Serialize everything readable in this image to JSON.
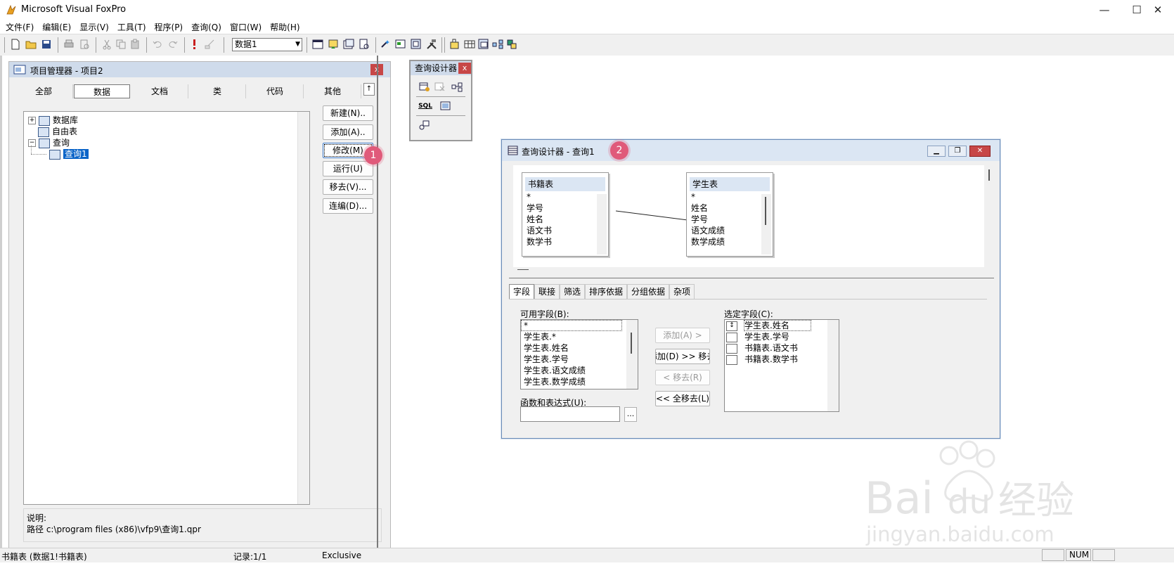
{
  "app": {
    "title": "Microsoft Visual FoxPro"
  },
  "menu": [
    "文件(F)",
    "编辑(E)",
    "显示(V)",
    "工具(T)",
    "程序(P)",
    "查询(Q)",
    "窗口(W)",
    "帮助(H)"
  ],
  "toolbar": {
    "database_select": "数据1"
  },
  "project_manager": {
    "title": "项目管理器 - 项目2",
    "close": "x",
    "tabs": [
      "全部",
      "数据",
      "文档",
      "类",
      "代码",
      "其他"
    ],
    "active_tab": "数据",
    "collapse_label": "↑",
    "tree": [
      {
        "label": "数据库",
        "exp": "+"
      },
      {
        "label": "自由表",
        "exp": ""
      },
      {
        "label": "查询",
        "exp": "−"
      },
      {
        "label": "查询1",
        "exp": ""
      }
    ],
    "buttons": [
      "新建(N)..",
      "添加(A)..",
      "修改(M)",
      "运行(U)",
      "移去(V)...",
      "连编(D)..."
    ],
    "description_label": "说明:",
    "path": "路径 c:\\program files (x86)\\vfp9\\查询1.qpr"
  },
  "badges": {
    "one": "1",
    "two": "2"
  },
  "query_palette": {
    "title": "查询设计器",
    "close": "x",
    "sql_label": "SQL"
  },
  "query_designer": {
    "title": "查询设计器 - 查询1",
    "close": "✕",
    "tables": [
      {
        "name": "书籍表",
        "fields": [
          "*",
          "学号",
          "姓名",
          "语文书",
          "数学书"
        ]
      },
      {
        "name": "学生表",
        "fields": [
          "*",
          "姓名",
          "学号",
          "语文成绩",
          "数学成绩"
        ]
      }
    ],
    "tabs": [
      "字段",
      "联接",
      "筛选",
      "排序依据",
      "分组依据",
      "杂项"
    ],
    "available_label": "可用字段(B):",
    "available_fields": [
      "*",
      "学生表.*",
      "学生表.姓名",
      "学生表.学号",
      "学生表.语文成绩",
      "学生表.数学成绩"
    ],
    "expr_label": "函数和表达式(U):",
    "expr_button": "...",
    "selected_label": "选定字段(C):",
    "selected_fields": [
      "学生表.姓名",
      "学生表.学号",
      "书籍表.语文书",
      "书籍表.数学书"
    ],
    "buttons": {
      "add": "添加(A) >",
      "add_all": "添加(D) >> 移去",
      "remove": "< 移去(R)",
      "remove_all": "<< 全移去(L)"
    }
  },
  "status": {
    "table": "书籍表 (数据1!书籍表)",
    "record": "记录:1/1",
    "mode": "Exclusive",
    "num": "NUM"
  },
  "watermark": {
    "brand": "Bai",
    "brand2": "du",
    "cn": "经验",
    "url": "jingyan.baidu.com"
  }
}
